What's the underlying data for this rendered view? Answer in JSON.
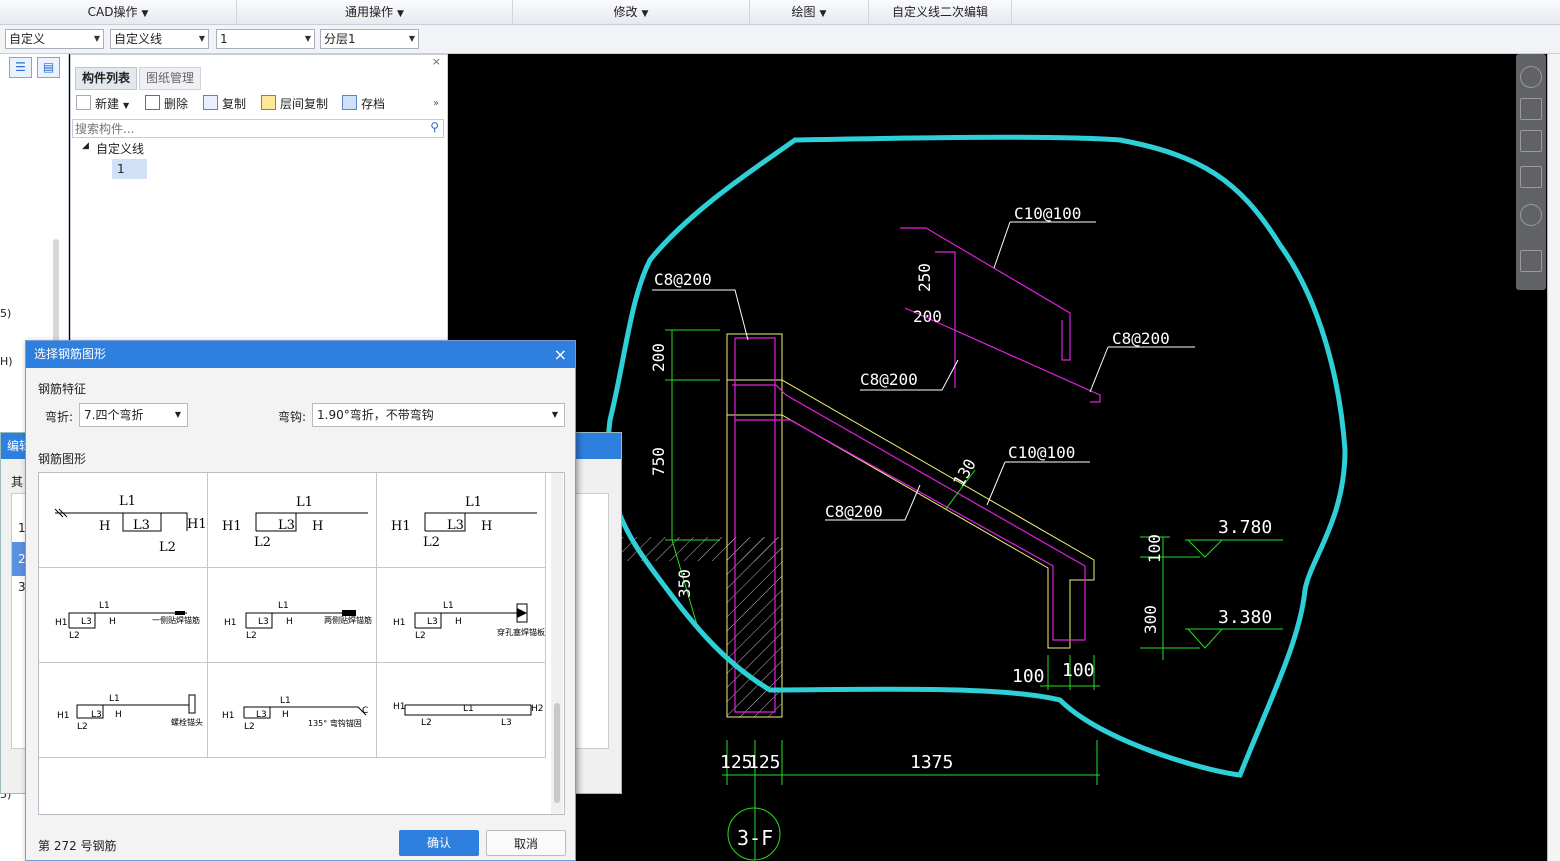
{
  "menu": [
    {
      "label": "CAD操作"
    },
    {
      "label": "通用操作"
    },
    {
      "label": "修改"
    },
    {
      "label": "绘图"
    },
    {
      "label": "自定义线二次编辑"
    }
  ],
  "toolbar": {
    "combos": [
      "自定义",
      "自定义线",
      "1",
      "分层1"
    ]
  },
  "panel": {
    "tabs": [
      "构件列表",
      "图纸管理"
    ],
    "buttons": [
      "新建",
      "删除",
      "复制",
      "层间复制",
      "存档"
    ],
    "more": "»",
    "search_placeholder": "搜索构件...",
    "tree_root": "自定义线",
    "tree_child": "1"
  },
  "bg_window": {
    "title": "编辑",
    "label": "其",
    "rows": [
      "1",
      "2",
      "3"
    ]
  },
  "left_strip_fragments": [
    "5)",
    "H)",
    "5)"
  ],
  "dialog": {
    "title": "选择钢筋图形",
    "close": "×",
    "section_feature": "钢筋特征",
    "bend_label": "弯折:",
    "bend_value": "7.四个弯折",
    "hook_label": "弯钩:",
    "hook_value": "1.90°弯折，不带弯钩",
    "section_shape": "钢筋图形",
    "status": "第 272 号钢筋",
    "ok": "确认",
    "cancel": "取消",
    "shapes": [
      {
        "labels": [
          "L1",
          "H",
          "L3",
          "H1",
          "L2"
        ]
      },
      {
        "labels": [
          "H1",
          "L1",
          "L3",
          "H",
          "L2"
        ]
      },
      {
        "labels": [
          "H1",
          "L1",
          "L3",
          "H",
          "L2"
        ]
      },
      {
        "labels": [
          "H1",
          "L3",
          "L1",
          "H",
          "L2",
          "一侧贴焊锚筋"
        ]
      },
      {
        "labels": [
          "H1",
          "L3",
          "L1",
          "H",
          "L2",
          "两侧贴焊锚筋"
        ]
      },
      {
        "labels": [
          "H1",
          "L3",
          "L1",
          "H",
          "L2",
          "穿孔塞焊锚板"
        ]
      },
      {
        "labels": [
          "H1",
          "L3",
          "L1",
          "H",
          "L2",
          "螺栓锚头"
        ]
      },
      {
        "labels": [
          "H1",
          "L3",
          "L1",
          "H",
          "L2",
          "C",
          "135° 弯钩锚固"
        ]
      },
      {
        "labels": [
          "H1",
          "L2",
          "L1",
          "L3",
          "H2"
        ]
      }
    ]
  },
  "cad": {
    "labels": {
      "c10_top": "C10@100",
      "c8_left": "C8@200",
      "c8_right": "C8@200",
      "c8_mid": "C8@200",
      "c10_mid": "C10@100",
      "c8_low": "C8@200",
      "d250": "250",
      "d200a": "200",
      "d200b": "200",
      "d750": "750",
      "d350": "350",
      "d130": "130",
      "d100a": "100",
      "d300": "300",
      "d100b": "100",
      "d100c": "100",
      "lv1": "3.780",
      "lv2": "3.380",
      "dim125a": "125",
      "dim125b": "125",
      "dim1375": "1375",
      "axis": "3-F"
    },
    "colors": {
      "green": "#22e022",
      "magenta": "#e020e0",
      "cyan": "#2ecfd6",
      "yellow": "#f2f277"
    }
  }
}
